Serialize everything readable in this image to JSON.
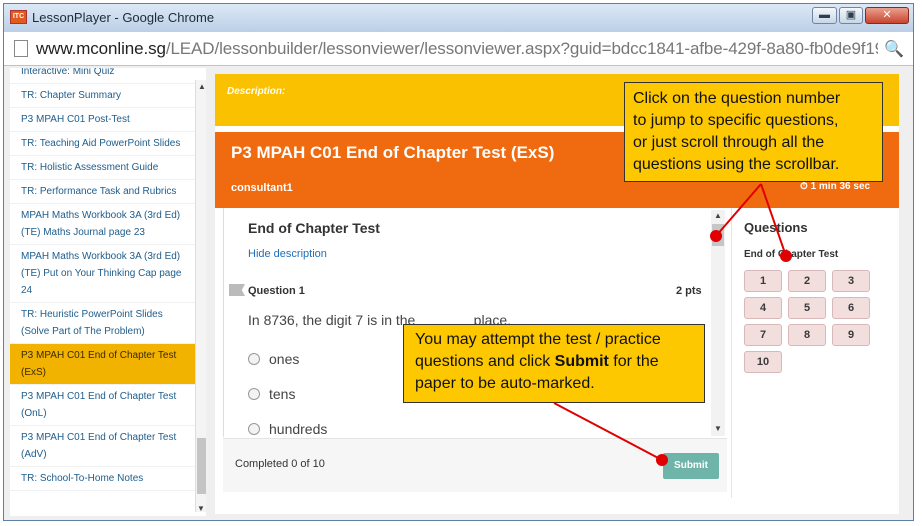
{
  "window": {
    "title": "LessonPlayer - Google Chrome",
    "app_icon_text": "ITC",
    "min": "▬",
    "max": "▣",
    "close": "✕"
  },
  "address": {
    "url_domain": "www.mconline.sg",
    "url_path": "/LEAD/lessonbuilder/lessonviewer/lessonviewer.aspx?guid=bdcc1841-afbe-429f-8a80-fb0de9f19",
    "zoom_icon": "🔍"
  },
  "sidebar": {
    "items": [
      {
        "label": "Interactive: Mini Quiz"
      },
      {
        "label": "TR: Chapter Summary"
      },
      {
        "label": "P3 MPAH C01 Post-Test"
      },
      {
        "label": "TR: Teaching Aid PowerPoint Slides"
      },
      {
        "label": "TR: Holistic Assessment Guide"
      },
      {
        "label": "TR: Performance Task and Rubrics"
      },
      {
        "label": "MPAH Maths Workbook 3A (3rd Ed)(TE) Maths Journal page 23"
      },
      {
        "label": "MPAH Maths Workbook 3A (3rd Ed)(TE) Put on Your Thinking Cap page 24"
      },
      {
        "label": "TR: Heuristic PowerPoint Slides (Solve Part of The Problem)"
      },
      {
        "label": "P3 MPAH C01 End of Chapter Test (ExS)"
      },
      {
        "label": "P3 MPAH C01 End of Chapter Test (OnL)"
      },
      {
        "label": "P3 MPAH C01 End of Chapter Test (AdV)"
      },
      {
        "label": "TR: School-To-Home Notes"
      }
    ],
    "active_index": 9
  },
  "description": {
    "label": "Description:"
  },
  "test": {
    "title": "P3 MPAH C01 End of Chapter Test (ExS)",
    "user": "consultant1",
    "timer": "⏱ 1 min 36 sec"
  },
  "question_panel": {
    "title": "End of Chapter Test",
    "hide_description": "Hide description",
    "question_label": "Question 1",
    "points": "2 pts",
    "question_text": "In 8736, the digit 7 is in the               place.",
    "options": [
      "ones",
      "tens",
      "hundreds"
    ]
  },
  "footer": {
    "completed": "Completed 0 of 10",
    "submit_label": "Submit"
  },
  "question_nav": {
    "title": "Questions",
    "section": "End of Chapter Test",
    "numbers": [
      "1",
      "2",
      "3",
      "4",
      "5",
      "6",
      "7",
      "8",
      "9",
      "10"
    ]
  },
  "callouts": {
    "nav_tip": [
      "Click on the question number",
      "to jump to specific questions,",
      "or just scroll through all the",
      "questions using the scrollbar."
    ],
    "submit_tip_before": "You may attempt the test / practice questions and click ",
    "submit_tip_bold": "Submit",
    "submit_tip_after": " for the paper to be auto-marked."
  },
  "colors": {
    "description_bar": "#f9c100",
    "header": "#f06a0f",
    "active_item": "#f2b200",
    "submit": "#6eb4a8",
    "callout": "#fdc800",
    "pointer": "#e00000"
  }
}
